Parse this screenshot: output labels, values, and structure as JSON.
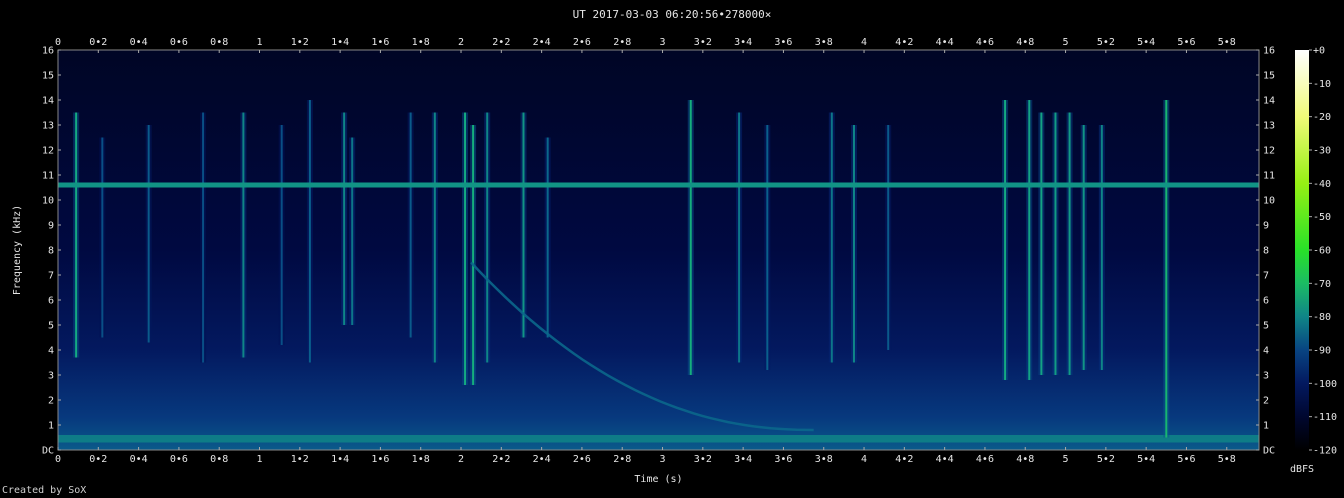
{
  "title": "UT 2017-03-03 06:20:56•278000×",
  "credit": "Created by SoX",
  "chart_data": {
    "type": "heatmap",
    "xlabel": "Time (s)",
    "ylabel": "Frequency (kHz)",
    "xlim": [
      0,
      5.96
    ],
    "ylim": [
      0,
      16
    ],
    "x_ticks": [
      {
        "v": 0,
        "label": "0"
      },
      {
        "v": 0.2,
        "label": "0•2"
      },
      {
        "v": 0.4,
        "label": "0•4"
      },
      {
        "v": 0.6,
        "label": "0•6"
      },
      {
        "v": 0.8,
        "label": "0•8"
      },
      {
        "v": 1,
        "label": "1"
      },
      {
        "v": 1.2,
        "label": "1•2"
      },
      {
        "v": 1.4,
        "label": "1•4"
      },
      {
        "v": 1.6,
        "label": "1•6"
      },
      {
        "v": 1.8,
        "label": "1•8"
      },
      {
        "v": 2,
        "label": "2"
      },
      {
        "v": 2.2,
        "label": "2•2"
      },
      {
        "v": 2.4,
        "label": "2•4"
      },
      {
        "v": 2.6,
        "label": "2•6"
      },
      {
        "v": 2.8,
        "label": "2•8"
      },
      {
        "v": 3,
        "label": "3"
      },
      {
        "v": 3.2,
        "label": "3•2"
      },
      {
        "v": 3.4,
        "label": "3•4"
      },
      {
        "v": 3.6,
        "label": "3•6"
      },
      {
        "v": 3.8,
        "label": "3•8"
      },
      {
        "v": 4,
        "label": "4"
      },
      {
        "v": 4.2,
        "label": "4•2"
      },
      {
        "v": 4.4,
        "label": "4•4"
      },
      {
        "v": 4.6,
        "label": "4•6"
      },
      {
        "v": 4.8,
        "label": "4•8"
      },
      {
        "v": 5,
        "label": "5"
      },
      {
        "v": 5.2,
        "label": "5•2"
      },
      {
        "v": 5.4,
        "label": "5•4"
      },
      {
        "v": 5.6,
        "label": "5•6"
      },
      {
        "v": 5.8,
        "label": "5•8"
      }
    ],
    "y_ticks": [
      {
        "v": 0,
        "label": "DC"
      },
      {
        "v": 1,
        "label": "1"
      },
      {
        "v": 2,
        "label": "2"
      },
      {
        "v": 3,
        "label": "3"
      },
      {
        "v": 4,
        "label": "4"
      },
      {
        "v": 5,
        "label": "5"
      },
      {
        "v": 6,
        "label": "6"
      },
      {
        "v": 7,
        "label": "7"
      },
      {
        "v": 8,
        "label": "8"
      },
      {
        "v": 9,
        "label": "9"
      },
      {
        "v": 10,
        "label": "10"
      },
      {
        "v": 11,
        "label": "11"
      },
      {
        "v": 12,
        "label": "12"
      },
      {
        "v": 13,
        "label": "13"
      },
      {
        "v": 14,
        "label": "14"
      },
      {
        "v": 15,
        "label": "15"
      },
      {
        "v": 16,
        "label": "16"
      }
    ],
    "colorbar": {
      "label": "dBFS",
      "ticks": [
        "+0",
        "-10",
        "-20",
        "-30",
        "-40",
        "-50",
        "-60",
        "-70",
        "-80",
        "-90",
        "-100",
        "-110",
        "-120"
      ],
      "range": [
        -120,
        0
      ]
    },
    "features": {
      "tone_khz": 10.6,
      "tone_level_db": -78,
      "noise_floor_db": -108,
      "low_band_khz": [
        0.3,
        0.6
      ],
      "sferics": [
        {
          "t": 0.09,
          "f_lo": 3.7,
          "f_hi": 13.5,
          "db": -75
        },
        {
          "t": 0.22,
          "f_lo": 4.5,
          "f_hi": 12.5,
          "db": -88
        },
        {
          "t": 0.45,
          "f_lo": 4.3,
          "f_hi": 13.0,
          "db": -86
        },
        {
          "t": 0.72,
          "f_lo": 3.5,
          "f_hi": 13.5,
          "db": -88
        },
        {
          "t": 0.92,
          "f_lo": 3.7,
          "f_hi": 13.5,
          "db": -80
        },
        {
          "t": 1.11,
          "f_lo": 4.2,
          "f_hi": 13.0,
          "db": -88
        },
        {
          "t": 1.25,
          "f_lo": 3.5,
          "f_hi": 14.0,
          "db": -85
        },
        {
          "t": 1.42,
          "f_lo": 5.0,
          "f_hi": 13.5,
          "db": -80
        },
        {
          "t": 1.46,
          "f_lo": 5.0,
          "f_hi": 12.5,
          "db": -82
        },
        {
          "t": 1.75,
          "f_lo": 4.5,
          "f_hi": 13.5,
          "db": -86
        },
        {
          "t": 1.87,
          "f_lo": 3.5,
          "f_hi": 13.5,
          "db": -80
        },
        {
          "t": 2.02,
          "f_lo": 2.6,
          "f_hi": 13.5,
          "db": -75
        },
        {
          "t": 2.06,
          "f_lo": 2.6,
          "f_hi": 13.0,
          "db": -74
        },
        {
          "t": 2.13,
          "f_lo": 3.5,
          "f_hi": 13.5,
          "db": -80
        },
        {
          "t": 2.31,
          "f_lo": 4.5,
          "f_hi": 13.5,
          "db": -78
        },
        {
          "t": 2.43,
          "f_lo": 4.5,
          "f_hi": 12.5,
          "db": -84
        },
        {
          "t": 3.14,
          "f_lo": 3.0,
          "f_hi": 14.0,
          "db": -74
        },
        {
          "t": 3.38,
          "f_lo": 3.5,
          "f_hi": 13.5,
          "db": -82
        },
        {
          "t": 3.52,
          "f_lo": 3.2,
          "f_hi": 13.0,
          "db": -85
        },
        {
          "t": 3.84,
          "f_lo": 3.5,
          "f_hi": 13.5,
          "db": -82
        },
        {
          "t": 3.95,
          "f_lo": 3.5,
          "f_hi": 13.0,
          "db": -80
        },
        {
          "t": 4.12,
          "f_lo": 4.0,
          "f_hi": 13.0,
          "db": -86
        },
        {
          "t": 4.7,
          "f_lo": 2.8,
          "f_hi": 14.0,
          "db": -75
        },
        {
          "t": 4.82,
          "f_lo": 2.8,
          "f_hi": 14.0,
          "db": -76
        },
        {
          "t": 4.88,
          "f_lo": 3.0,
          "f_hi": 13.5,
          "db": -76
        },
        {
          "t": 4.95,
          "f_lo": 3.0,
          "f_hi": 13.5,
          "db": -77
        },
        {
          "t": 5.02,
          "f_lo": 3.0,
          "f_hi": 13.5,
          "db": -77
        },
        {
          "t": 5.09,
          "f_lo": 3.2,
          "f_hi": 13.0,
          "db": -78
        },
        {
          "t": 5.18,
          "f_lo": 3.2,
          "f_hi": 13.0,
          "db": -80
        },
        {
          "t": 5.5,
          "f_lo": 0.5,
          "f_hi": 14.0,
          "db": -72
        }
      ],
      "whistler": {
        "t_start": 2.05,
        "t_end": 3.75,
        "f_start": 7.5,
        "f_end": 0.8,
        "db": -84
      }
    }
  }
}
